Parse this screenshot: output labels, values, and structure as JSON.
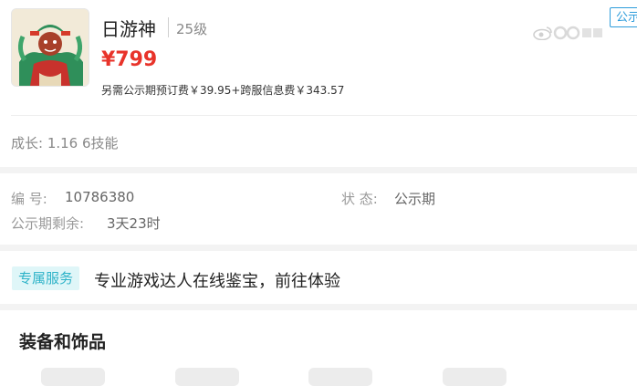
{
  "character": {
    "name": "日游神",
    "level": "25级",
    "price": "¥799",
    "extra_fees": "另需公示期预订费￥39.95+跨服信息费￥343.57",
    "status_tag": "公示期",
    "avatar_icon": "character-portrait"
  },
  "growth": "成长: 1.16 6技能",
  "info": {
    "id_label": "编 号:",
    "id_value": "10786380",
    "status_label": "状 态:",
    "status_value": "公示期",
    "remaining_label": "公示期剩余:",
    "remaining_value": "3天23时"
  },
  "service": {
    "tag": "专属服务",
    "text": "专业游戏达人在线鉴宝，前往体验"
  },
  "equipment": {
    "title": "装备和饰品"
  },
  "colors": {
    "price": "#e8332a",
    "accent_blue": "#2d9cdb",
    "service_bg": "#dff6f8",
    "service_text": "#2eb3c8"
  }
}
